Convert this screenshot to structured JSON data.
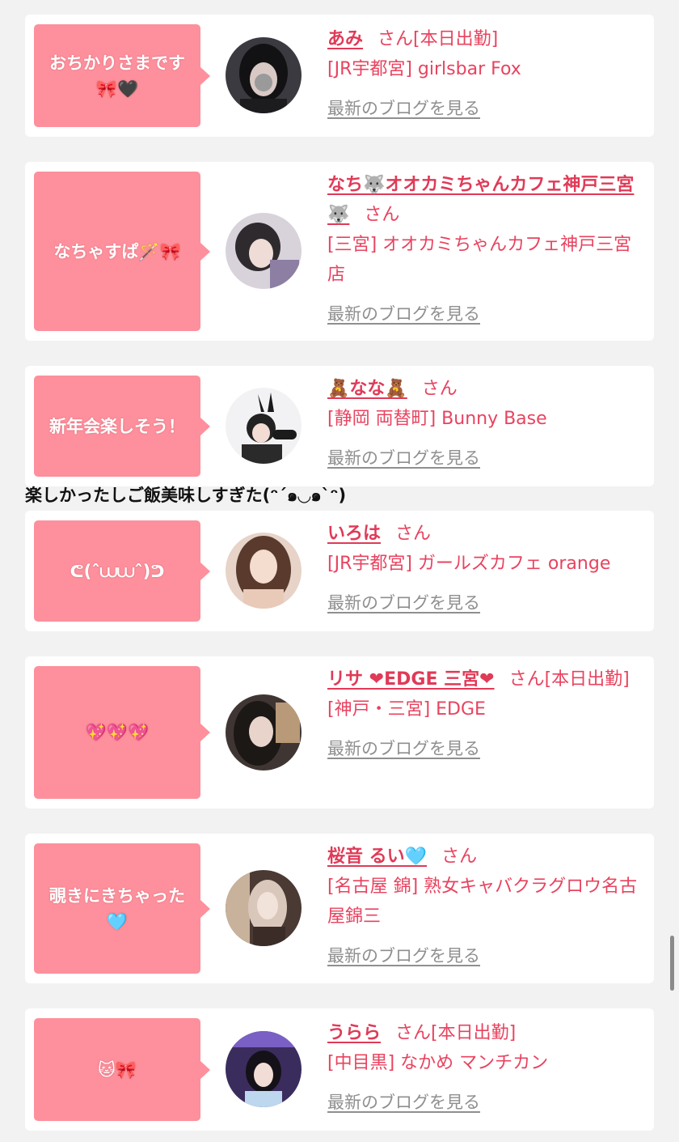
{
  "entries": [
    {
      "bubble": "おちかりさまです\n🎀🖤",
      "name": "あみ",
      "honorific": "さん[本日出勤]",
      "shop": "[JR宇都宮] girlsbar Fox",
      "blog": "最新のブログを見る"
    },
    {
      "bubble": "なちゃすぱ🪄🎀",
      "name": "なち🐺オオカミちゃんカフェ神戸三宮🐺",
      "honorific": "さん",
      "shop": "[三宮] オオカミちゃんカフェ神戸三宮店",
      "blog": "最新のブログを見る"
    },
    {
      "bubble": "新年会楽しそう！",
      "name": "🧸なな🧸",
      "honorific": "さん",
      "shop": "[静岡 両替町] Bunny Base",
      "blog": "最新のブログを見る"
    },
    {
      "bubble": "ᕦ(ˆ⩊⩊ˆ)ᕤ",
      "name": "いろは",
      "honorific": "さん",
      "shop": "[JR宇都宮] ガールズカフェ orange",
      "blog": "最新のブログを見る"
    },
    {
      "bubble": "💖💖💖",
      "name": "リサ ❤EDGE 三宮❤",
      "honorific": "さん[本日出勤]",
      "shop": "[神戸・三宮] EDGE",
      "blog": "最新のブログを見る"
    },
    {
      "bubble": "覗きにきちゃった\n🩵",
      "name": "桜音 るい🩵",
      "honorific": "さん",
      "shop": "[名古屋 錦] 熟女キャバクラグロウ名古屋錦三",
      "blog": "最新のブログを見る"
    },
    {
      "bubble": "🐱🎀",
      "name": "うらら",
      "honorific": "さん[本日出勤]",
      "shop": "[中目黒] なかめ マンチカン",
      "blog": "最新のブログを見る"
    }
  ],
  "caption": "楽しかったしご飯美味しすぎた(ᵔˊ๑◡๑ˋᵔ)",
  "avatars": [
    {
      "icon": "avatar-photo-1",
      "bg": "#2a2a2e"
    },
    {
      "icon": "avatar-photo-2",
      "bg": "#cfc9d3"
    },
    {
      "icon": "avatar-photo-3",
      "bg": "#e9e9ec"
    },
    {
      "icon": "avatar-photo-4",
      "bg": "#c99c84"
    },
    {
      "icon": "avatar-photo-5",
      "bg": "#4a3d3a"
    },
    {
      "icon": "avatar-photo-6",
      "bg": "#3a2f2c"
    },
    {
      "icon": "avatar-photo-7",
      "bg": "#3b2c5e"
    }
  ]
}
